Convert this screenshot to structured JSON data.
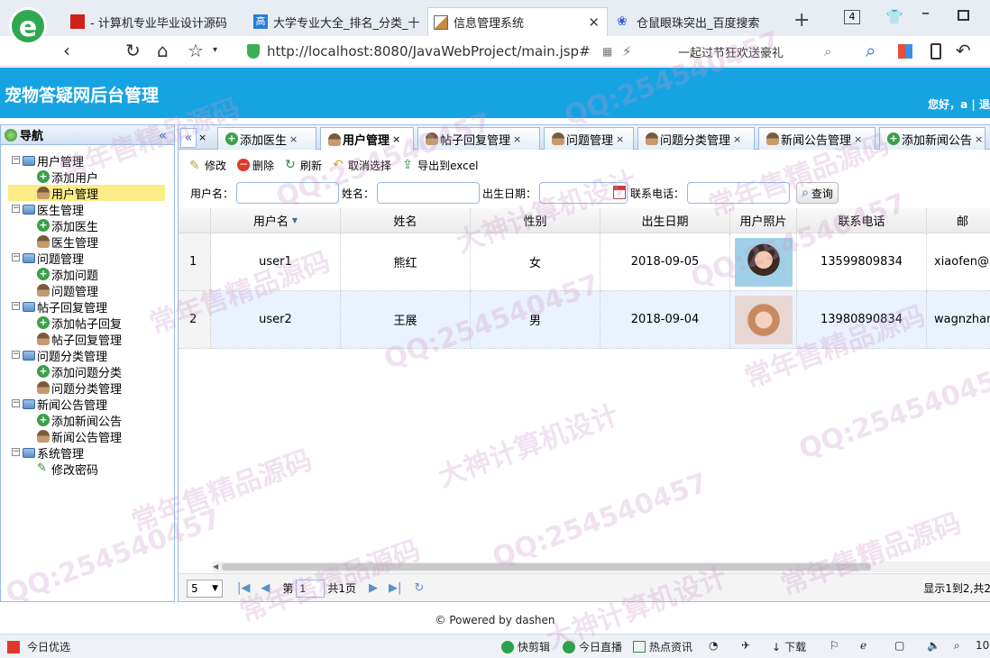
{
  "browser": {
    "tabs": [
      {
        "label": "- 计算机专业毕业设计源码",
        "active": false
      },
      {
        "label": "大学专业大全_排名_分类_十",
        "active": false
      },
      {
        "label": "信息管理系统",
        "active": true
      },
      {
        "label": "仓鼠眼珠突出_百度搜索",
        "active": false
      }
    ],
    "tab_count": "4",
    "new_tab": "+",
    "url": "http://localhost:8080/JavaWebProject/main.jsp#",
    "ad_text": "一起过节狂欢送豪礼"
  },
  "app": {
    "title": "宠物答疑网后台管理",
    "greeting": "您好，a | 退"
  },
  "nav": {
    "title": "导航",
    "collapse_icon": "«",
    "groups": [
      {
        "label": "用户管理",
        "children": [
          {
            "label": "添加用户",
            "icon": "add-icon"
          },
          {
            "label": "用户管理",
            "icon": "user-icon",
            "selected": true
          }
        ]
      },
      {
        "label": "医生管理",
        "children": [
          {
            "label": "添加医生",
            "icon": "add-icon"
          },
          {
            "label": "医生管理",
            "icon": "user-icon"
          }
        ]
      },
      {
        "label": "问题管理",
        "children": [
          {
            "label": "添加问题",
            "icon": "add-icon"
          },
          {
            "label": "问题管理",
            "icon": "user-icon"
          }
        ]
      },
      {
        "label": "帖子回复管理",
        "children": [
          {
            "label": "添加帖子回复",
            "icon": "add-icon"
          },
          {
            "label": "帖子回复管理",
            "icon": "user-icon"
          }
        ]
      },
      {
        "label": "问题分类管理",
        "children": [
          {
            "label": "添加问题分类",
            "icon": "add-icon"
          },
          {
            "label": "问题分类管理",
            "icon": "user-icon"
          }
        ]
      },
      {
        "label": "新闻公告管理",
        "children": [
          {
            "label": "添加新闻公告",
            "icon": "add-icon"
          },
          {
            "label": "新闻公告管理",
            "icon": "user-icon"
          }
        ]
      },
      {
        "label": "系统管理",
        "children": [
          {
            "label": "修改密码",
            "icon": "pencil-icon"
          }
        ]
      }
    ]
  },
  "tabs": [
    {
      "label": "添加医生",
      "icon": "add-icon"
    },
    {
      "label": "用户管理",
      "icon": "user-icon",
      "active": true
    },
    {
      "label": "帖子回复管理",
      "icon": "user-icon"
    },
    {
      "label": "问题管理",
      "icon": "user-icon"
    },
    {
      "label": "问题分类管理",
      "icon": "user-icon"
    },
    {
      "label": "新闻公告管理",
      "icon": "user-icon"
    },
    {
      "label": "添加新闻公告",
      "icon": "add-icon"
    }
  ],
  "toolbar": {
    "edit": "修改",
    "delete": "删除",
    "refresh": "刷新",
    "unselect": "取消选择",
    "export": "导出到excel"
  },
  "search": {
    "username_label": "用户名：",
    "name_label": "姓名：",
    "birthday_label": "出生日期：",
    "phone_label": "联系电话：",
    "query_button": "查询"
  },
  "grid": {
    "columns": [
      "用户名",
      "姓名",
      "性别",
      "出生日期",
      "用户照片",
      "联系电话",
      "邮"
    ],
    "rows": [
      {
        "num": "1",
        "username": "user1",
        "name": "熊红",
        "gender": "女",
        "birthday": "2018-09-05",
        "phone": "13599809834",
        "email": "xiaofen@"
      },
      {
        "num": "2",
        "username": "user2",
        "name": "王展",
        "gender": "男",
        "birthday": "2018-09-04",
        "phone": "13980890834",
        "email": "wagnzhan"
      }
    ]
  },
  "pager": {
    "page_size": "5",
    "page_prefix": "第",
    "page_value": "1",
    "page_total": "共1页",
    "summary": "显示1到2,共2"
  },
  "footer": "© Powered by dashen",
  "statusbar": {
    "left": "今日优选",
    "items": [
      "快剪辑",
      "今日直播",
      "热点资讯",
      "下载"
    ],
    "zoom": "10"
  },
  "watermarks": [
    "QQ:254540457",
    "常年售精品源码",
    "大神计算机设计"
  ]
}
